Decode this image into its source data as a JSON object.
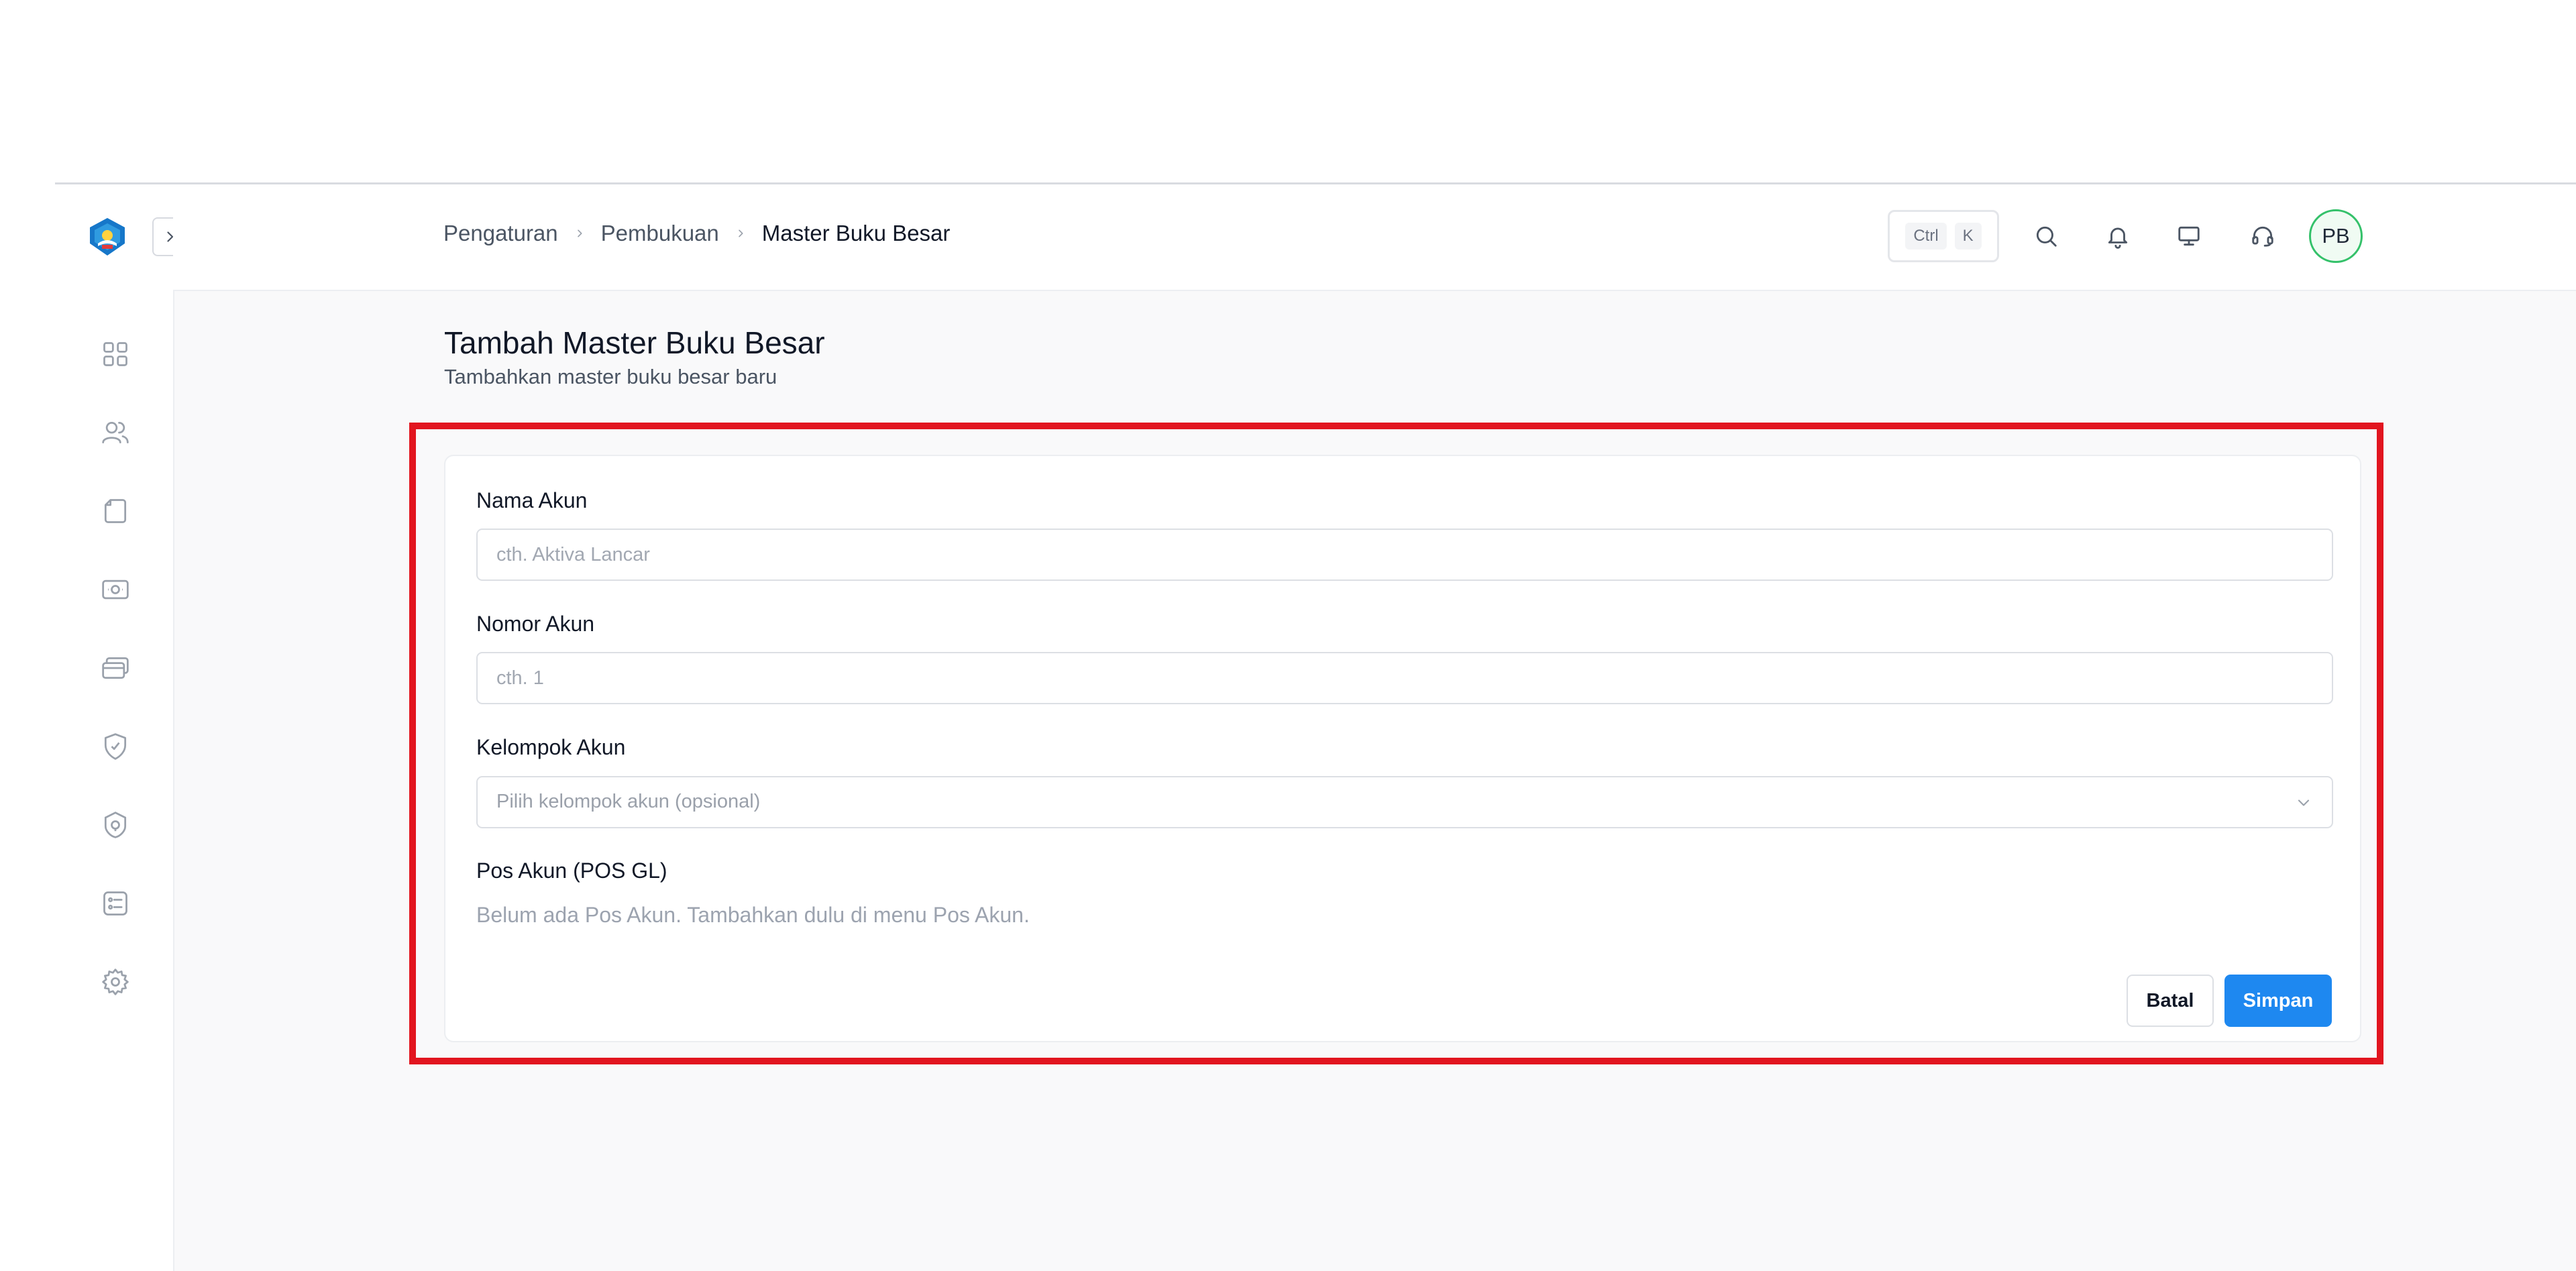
{
  "breadcrumb": {
    "items": [
      "Pengaturan",
      "Pembukuan"
    ],
    "current": "Master Buku Besar"
  },
  "shortcut": {
    "keys": [
      "Ctrl",
      "K"
    ]
  },
  "header_icons": [
    "search-icon",
    "bell-icon",
    "monitor-icon",
    "headset-icon"
  ],
  "user": {
    "initials": "PB"
  },
  "sidebar": {
    "icons": [
      "dashboard-icon",
      "users-icon",
      "document-icon",
      "money-icon",
      "cards-icon",
      "shield-icon",
      "lock-icon",
      "list-icon",
      "gear-icon"
    ]
  },
  "page": {
    "title": "Tambah Master Buku Besar",
    "subtitle": "Tambahkan master buku besar baru"
  },
  "form": {
    "nama_akun": {
      "label": "Nama Akun",
      "placeholder": "cth. Aktiva Lancar",
      "value": ""
    },
    "nomor_akun": {
      "label": "Nomor Akun",
      "placeholder": "cth. 1",
      "value": ""
    },
    "kelompok_akun": {
      "label": "Kelompok Akun",
      "placeholder": "Pilih kelompok akun (opsional)"
    },
    "pos_akun": {
      "label": "Pos Akun (POS GL)",
      "empty_message": "Belum ada Pos Akun. Tambahkan dulu di menu Pos Akun."
    },
    "cancel_label": "Batal",
    "save_label": "Simpan"
  },
  "colors": {
    "primary": "#1e88f0",
    "highlight": "#e2151f",
    "avatar_border": "#34c16a"
  }
}
